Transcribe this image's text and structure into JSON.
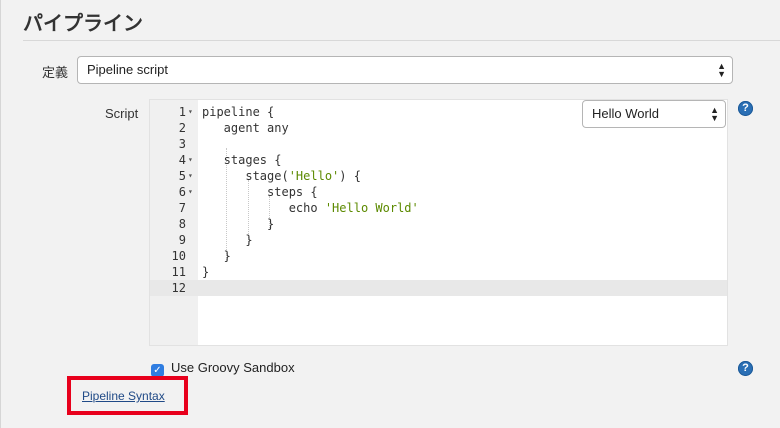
{
  "section": {
    "title": "パイプライン"
  },
  "definition": {
    "label": "定義",
    "selected": "Pipeline script"
  },
  "script": {
    "label": "Script",
    "sample_selected": "Hello World",
    "lines": [
      {
        "n": "1",
        "fold": "▾",
        "parts": [
          {
            "t": "pipeline {",
            "s": ""
          }
        ]
      },
      {
        "n": "2",
        "fold": "",
        "parts": [
          {
            "t": "   agent any",
            "s": ""
          }
        ]
      },
      {
        "n": "3",
        "fold": "",
        "parts": [
          {
            "t": "",
            "s": ""
          }
        ]
      },
      {
        "n": "4",
        "fold": "▾",
        "parts": [
          {
            "t": "   stages {",
            "s": ""
          }
        ]
      },
      {
        "n": "5",
        "fold": "▾",
        "parts": [
          {
            "t": "      stage(",
            "s": ""
          },
          {
            "t": "'Hello'",
            "s": "str"
          },
          {
            "t": ") {",
            "s": ""
          }
        ]
      },
      {
        "n": "6",
        "fold": "▾",
        "parts": [
          {
            "t": "         steps {",
            "s": ""
          }
        ]
      },
      {
        "n": "7",
        "fold": "",
        "parts": [
          {
            "t": "            echo ",
            "s": ""
          },
          {
            "t": "'Hello World'",
            "s": "str"
          }
        ]
      },
      {
        "n": "8",
        "fold": "",
        "parts": [
          {
            "t": "         }",
            "s": ""
          }
        ]
      },
      {
        "n": "9",
        "fold": "",
        "parts": [
          {
            "t": "      }",
            "s": ""
          }
        ]
      },
      {
        "n": "10",
        "fold": "",
        "parts": [
          {
            "t": "   }",
            "s": ""
          }
        ]
      },
      {
        "n": "11",
        "fold": "",
        "parts": [
          {
            "t": "}",
            "s": ""
          }
        ]
      },
      {
        "n": "12",
        "fold": "",
        "parts": [
          {
            "t": "",
            "s": ""
          }
        ],
        "active": true
      }
    ]
  },
  "sandbox": {
    "label": "Use Groovy Sandbox",
    "checked": true
  },
  "help": {
    "glyph": "?"
  },
  "pipeline_syntax": {
    "label": "Pipeline Syntax"
  },
  "colors": {
    "highlight": "#e8001c",
    "link": "#204a87",
    "checkbox": "#2f7de1",
    "string": "#5c8a00"
  }
}
